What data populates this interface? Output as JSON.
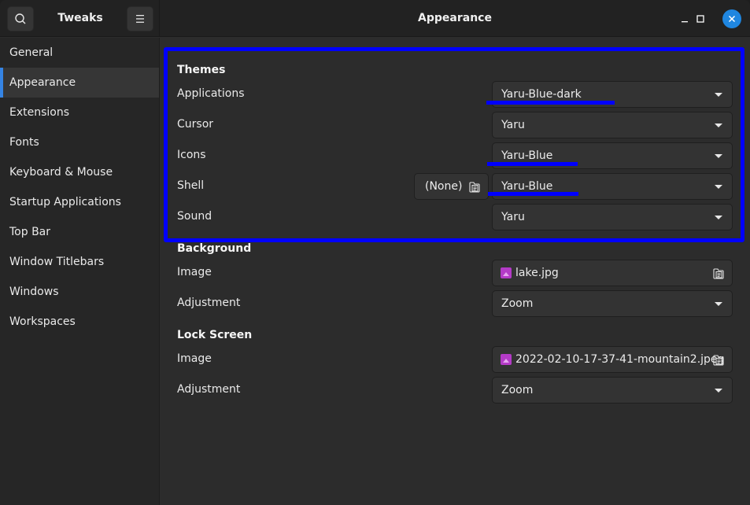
{
  "header": {
    "app_title": "Tweaks",
    "page_title": "Appearance",
    "search_icon": "search-icon",
    "menu_icon": "hamburger-menu-icon",
    "window_controls": [
      "minimize-icon",
      "maximize-icon",
      "close-icon"
    ]
  },
  "sidebar": {
    "items": [
      {
        "label": "General",
        "active": false
      },
      {
        "label": "Appearance",
        "active": true
      },
      {
        "label": "Extensions",
        "active": false
      },
      {
        "label": "Fonts",
        "active": false
      },
      {
        "label": "Keyboard & Mouse",
        "active": false
      },
      {
        "label": "Startup Applications",
        "active": false
      },
      {
        "label": "Top Bar",
        "active": false
      },
      {
        "label": "Window Titlebars",
        "active": false
      },
      {
        "label": "Windows",
        "active": false
      },
      {
        "label": "Workspaces",
        "active": false
      }
    ]
  },
  "themes": {
    "title": "Themes",
    "applications": {
      "label": "Applications",
      "value": "Yaru-Blue-dark"
    },
    "cursor": {
      "label": "Cursor",
      "value": "Yaru"
    },
    "icons": {
      "label": "Icons",
      "value": "Yaru-Blue"
    },
    "shell": {
      "label": "Shell",
      "file_label": "(None)",
      "value": "Yaru-Blue"
    },
    "sound": {
      "label": "Sound",
      "value": "Yaru"
    }
  },
  "background": {
    "title": "Background",
    "image": {
      "label": "Image",
      "value": "lake.jpg"
    },
    "adjustment": {
      "label": "Adjustment",
      "value": "Zoom"
    }
  },
  "lock_screen": {
    "title": "Lock Screen",
    "image": {
      "label": "Image",
      "value": "2022-02-10-17-37-41-mountain2.jpeg"
    },
    "adjustment": {
      "label": "Adjustment",
      "value": "Zoom"
    }
  },
  "annotations": {
    "highlight_color": "#0000ff",
    "accent_color": "#3584e4",
    "close_button_color": "#1f86e0"
  }
}
